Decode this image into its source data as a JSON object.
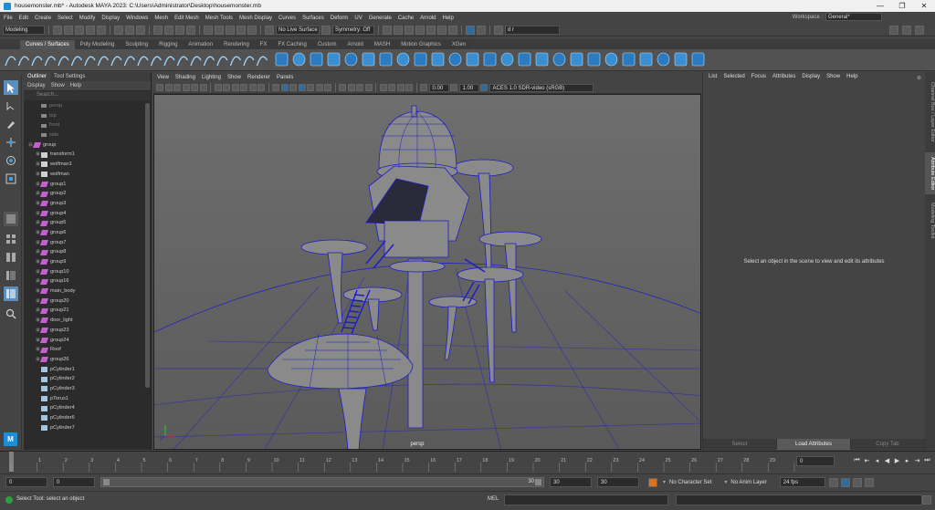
{
  "window": {
    "title": "housemonster.mb* - Autodesk MAYA 2023: C:\\Users\\Administrator\\Desktop\\housemonster.mb"
  },
  "menubar": {
    "items": [
      "File",
      "Edit",
      "Create",
      "Select",
      "Modify",
      "Display",
      "Windows",
      "Mesh",
      "Edit Mesh",
      "Mesh Tools",
      "Mesh Display",
      "Curves",
      "Surfaces",
      "Deform",
      "UV",
      "Generate",
      "Cache",
      "Arnold",
      "Help"
    ]
  },
  "workspace": {
    "label": "Workspace :",
    "value": "General*"
  },
  "statusline": {
    "mode": "Modeling",
    "live_surface": "No Live Surface",
    "symmetry": "Symmetry: Off",
    "user": "d r"
  },
  "shelf": {
    "tabs": [
      "Curves / Surfaces",
      "Poly Modeling",
      "Sculpting",
      "Rigging",
      "Animation",
      "Rendering",
      "FX",
      "FX Caching",
      "Custom",
      "Arnold",
      "MASH",
      "Motion Graphics",
      "XGen"
    ],
    "active": "Curves / Surfaces"
  },
  "outliner": {
    "tabs": [
      "Outliner",
      "Tool Settings"
    ],
    "menu": [
      "Display",
      "Show",
      "Help"
    ],
    "search_placeholder": "Search...",
    "items": [
      {
        "label": "persp",
        "type": "camera",
        "indent": 1,
        "dim": true
      },
      {
        "label": "top",
        "type": "camera",
        "indent": 1,
        "dim": true
      },
      {
        "label": "front",
        "type": "camera",
        "indent": 1,
        "dim": true
      },
      {
        "label": "side",
        "type": "camera",
        "indent": 1,
        "dim": true
      },
      {
        "label": "group",
        "type": "group",
        "indent": 0,
        "dim": false,
        "exp": "⊟"
      },
      {
        "label": "transform1",
        "type": "xform",
        "indent": 1,
        "dim": false,
        "exp": "⊞"
      },
      {
        "label": "wolfman1",
        "type": "xform",
        "indent": 1,
        "dim": false,
        "exp": "⊞"
      },
      {
        "label": "wolfman",
        "type": "xform",
        "indent": 1,
        "dim": false,
        "exp": "⊞"
      },
      {
        "label": "group1",
        "type": "group",
        "indent": 1,
        "dim": false,
        "exp": "⊞"
      },
      {
        "label": "group2",
        "type": "group",
        "indent": 1,
        "dim": false,
        "exp": "⊞"
      },
      {
        "label": "group3",
        "type": "group",
        "indent": 1,
        "dim": false,
        "exp": "⊞"
      },
      {
        "label": "group4",
        "type": "group",
        "indent": 1,
        "dim": false,
        "exp": "⊞"
      },
      {
        "label": "group5",
        "type": "group",
        "indent": 1,
        "dim": false,
        "exp": "⊞"
      },
      {
        "label": "group6",
        "type": "group",
        "indent": 1,
        "dim": false,
        "exp": "⊞"
      },
      {
        "label": "group7",
        "type": "group",
        "indent": 1,
        "dim": false,
        "exp": "⊞"
      },
      {
        "label": "group8",
        "type": "group",
        "indent": 1,
        "dim": false,
        "exp": "⊞"
      },
      {
        "label": "group9",
        "type": "group",
        "indent": 1,
        "dim": false,
        "exp": "⊞"
      },
      {
        "label": "group10",
        "type": "group",
        "indent": 1,
        "dim": false,
        "exp": "⊞"
      },
      {
        "label": "group16",
        "type": "group",
        "indent": 1,
        "dim": false,
        "exp": "⊞"
      },
      {
        "label": "main_body",
        "type": "group",
        "indent": 1,
        "dim": false,
        "exp": "⊞"
      },
      {
        "label": "group20",
        "type": "group",
        "indent": 1,
        "dim": false,
        "exp": "⊞"
      },
      {
        "label": "group21",
        "type": "group",
        "indent": 1,
        "dim": false,
        "exp": "⊞"
      },
      {
        "label": "door_light",
        "type": "group",
        "indent": 1,
        "dim": false,
        "exp": "⊞"
      },
      {
        "label": "group23",
        "type": "group",
        "indent": 1,
        "dim": false,
        "exp": "⊞"
      },
      {
        "label": "group24",
        "type": "group",
        "indent": 1,
        "dim": false,
        "exp": "⊞"
      },
      {
        "label": "Roof",
        "type": "group",
        "indent": 1,
        "dim": false,
        "exp": "⊞"
      },
      {
        "label": "group26",
        "type": "group",
        "indent": 1,
        "dim": false,
        "exp": "⊞"
      },
      {
        "label": "pCylinder1",
        "type": "mesh",
        "indent": 1,
        "dim": false,
        "exp": ""
      },
      {
        "label": "pCylinder2",
        "type": "mesh",
        "indent": 1,
        "dim": false,
        "exp": ""
      },
      {
        "label": "pCylinder3",
        "type": "mesh",
        "indent": 1,
        "dim": false,
        "exp": ""
      },
      {
        "label": "pTorus1",
        "type": "mesh",
        "indent": 1,
        "dim": false,
        "exp": ""
      },
      {
        "label": "pCylinder4",
        "type": "mesh",
        "indent": 1,
        "dim": false,
        "exp": ""
      },
      {
        "label": "pCylinder6",
        "type": "mesh",
        "indent": 1,
        "dim": false,
        "exp": ""
      },
      {
        "label": "pCylinder7",
        "type": "mesh",
        "indent": 1,
        "dim": false,
        "exp": ""
      }
    ]
  },
  "viewport": {
    "menu": [
      "View",
      "Shading",
      "Lighting",
      "Show",
      "Renderer",
      "Panels"
    ],
    "exposure": "0.00",
    "gamma": "1.00",
    "colorspace": "ACES 1.0 SDR-video (sRGB)",
    "camera_label": "persp",
    "accent": "#1c1cc8"
  },
  "attribute_editor": {
    "menu": [
      "List",
      "Selected",
      "Focus",
      "Attributes",
      "Display",
      "Show",
      "Help"
    ],
    "empty_message": "Select an object in the scene to view and edit its attributes",
    "buttons": [
      "Select",
      "Load Attributes",
      "Copy Tab"
    ]
  },
  "side_tabs": [
    "Channel Box / Layer Editor",
    "Attribute Editor",
    "Modeling Toolkit"
  ],
  "timeline": {
    "ticks": [
      "1",
      "2",
      "3",
      "4",
      "5",
      "6",
      "7",
      "8",
      "9",
      "10",
      "11",
      "12",
      "13",
      "14",
      "15",
      "16",
      "17",
      "18",
      "19",
      "20",
      "21",
      "22",
      "23",
      "24",
      "25",
      "26",
      "27",
      "28",
      "29",
      "30"
    ],
    "current_frame": "0"
  },
  "range": {
    "start": "0",
    "playback_start": "0",
    "range_end_label": "30",
    "playback_end": "30",
    "end": "30",
    "character_set": "No Character Set",
    "anim_layer": "No Anim Layer",
    "fps": "24 fps"
  },
  "command": {
    "help": "Select Tool: select an object",
    "lang": "MEL"
  }
}
